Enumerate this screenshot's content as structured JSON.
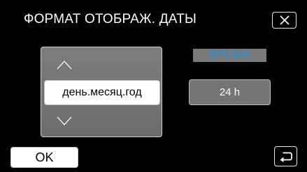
{
  "header": {
    "title": "ФОРМАТ ОТОБРАЖ. ДАТЫ"
  },
  "picker": {
    "selected_value": "день.месяц.год"
  },
  "time": {
    "label": "ВРЕМЯ",
    "value": "24 h"
  },
  "footer": {
    "ok_label": "OK"
  },
  "icons": {
    "close": "close-icon",
    "up": "chevron-up-icon",
    "down": "chevron-down-icon",
    "back": "back-arrow-icon"
  },
  "colors": {
    "background": "#000000",
    "picker": "#767676",
    "time_label_text": "#1e8fd8",
    "time_button": "#757575"
  }
}
